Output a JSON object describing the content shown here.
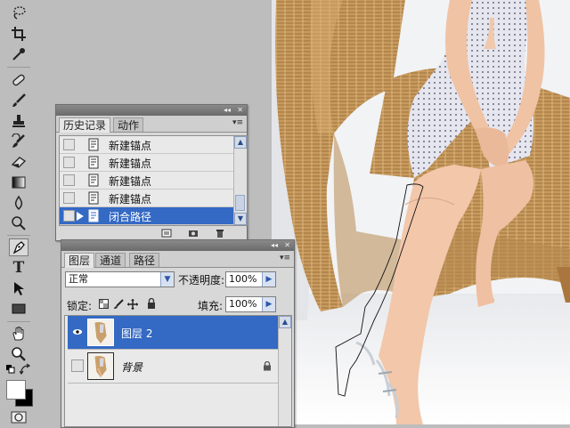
{
  "toolbar": {
    "tools": [
      "lasso-icon",
      "crop-icon",
      "eyedropper-icon",
      "healing-brush-icon",
      "brush-icon",
      "clone-stamp-icon",
      "history-brush-icon",
      "eraser-icon",
      "gradient-icon",
      "blur-icon",
      "dodge-icon",
      "pen-icon",
      "type-icon",
      "path-selection-icon",
      "rectangle-icon",
      "hand-icon",
      "zoom-icon",
      "default-colors-icon",
      "swap-colors-icon",
      "foreground-color-swatch",
      "quick-mask-icon"
    ],
    "active_tool": "pen-icon",
    "type_glyph": "T",
    "foreground_color": "#ffffff",
    "background_color": "#000000"
  },
  "history_panel": {
    "tabs": [
      "历史记录",
      "动作"
    ],
    "active_tab": "历史记录",
    "items": [
      {
        "label": "新建锚点",
        "selected": false
      },
      {
        "label": "新建锚点",
        "selected": false
      },
      {
        "label": "新建锚点",
        "selected": false
      },
      {
        "label": "新建锚点",
        "selected": false
      },
      {
        "label": "闭合路径",
        "selected": true
      }
    ],
    "footer_icons": [
      "new-document-from-state-icon",
      "new-snapshot-icon",
      "trash-icon"
    ],
    "collapse_glyph": "◂◂",
    "close_glyph": "✕",
    "menu_glyph": "▾≡"
  },
  "layers_panel": {
    "tabs": [
      "图层",
      "通道",
      "路径"
    ],
    "active_tab": "图层",
    "blend_mode": "正常",
    "opacity_label": "不透明度:",
    "opacity_value": "100%",
    "lock_label": "锁定:",
    "fill_label": "填充:",
    "fill_value": "100%",
    "collapse_glyph": "◂◂",
    "close_glyph": "✕",
    "menu_glyph": "▾≡",
    "layers": [
      {
        "name": "图层 2",
        "visible": true,
        "selected": true,
        "locked": false
      },
      {
        "name": "背景",
        "visible": false,
        "selected": false,
        "locked": true
      }
    ]
  },
  "colors": {
    "selection_blue": "#3469c4",
    "panel_bg": "#d8d8d8",
    "workspace_gray": "#bdbdbd"
  }
}
